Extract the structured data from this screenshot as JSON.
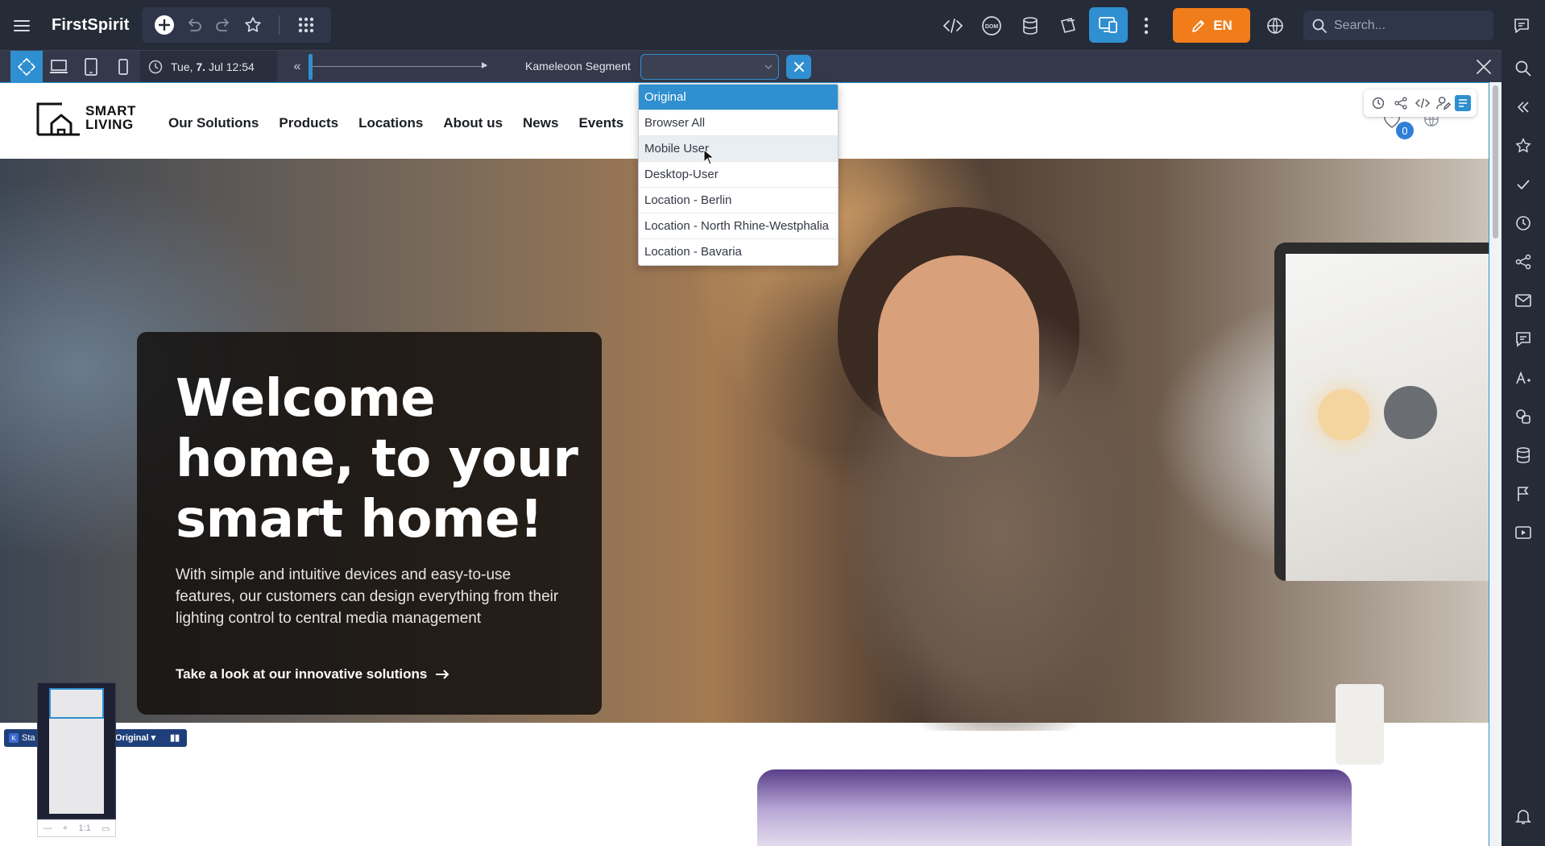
{
  "app": {
    "title": "FirstSpirit"
  },
  "topbar": {
    "edit_language": "EN",
    "search": {
      "placeholder": "Search..."
    }
  },
  "preview_toolbar": {
    "date": {
      "weekday": "Tue,",
      "day": "7.",
      "month": "Jul",
      "time": "12:54"
    },
    "segment_label": "Kameleoon Segment",
    "segment_value": "",
    "segment_options": [
      "Original",
      "Browser All",
      "Mobile User",
      "Desktop-User",
      "Location - Berlin",
      "Location - North Rhine-Westphalia",
      "Location - Bavaria"
    ],
    "selected_option": "Original",
    "hovered_option": "Mobile User"
  },
  "site": {
    "logo": {
      "line1": "SMART",
      "line2": "LIVING"
    },
    "nav": [
      "Our Solutions",
      "Products",
      "Locations",
      "About us",
      "News",
      "Events"
    ],
    "favorites_count": "0",
    "hero": {
      "title": "Welcome home, to your smart home!",
      "text": "With simple and intuitive devices and easy-to-use features, our customers can design everything from their lighting control to central media management",
      "cta": "Take a look at our innovative solutions"
    }
  },
  "kameleoon_bar": {
    "status": "Sta",
    "variant": "Original"
  },
  "minimap": {
    "zoom": "1:1"
  },
  "colors": {
    "accent": "#2f8fd0",
    "edit_button": "#f07d1a",
    "chrome": "#262b38"
  }
}
